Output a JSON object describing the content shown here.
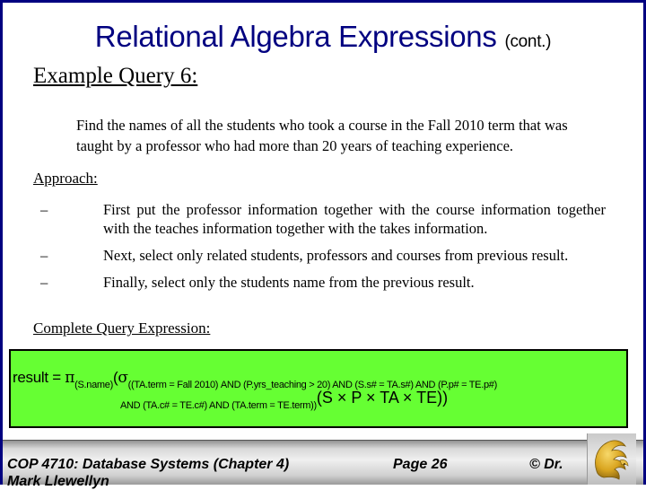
{
  "slide": {
    "title": "Relational Algebra Expressions",
    "title_suffix": "(cont.)",
    "query_heading": "Example Query 6:",
    "description": "Find the names of all the students who took a course in the Fall 2010 term that was taught by a professor who had more than 20 years of teaching experience.",
    "approach_heading": "Approach:",
    "bullets": [
      {
        "marker": "–",
        "text": "First put the professor information together with the course information together with the teaches information together with the takes information."
      },
      {
        "marker": "–",
        "text": "Next,  select only related students, professors and courses from previous result."
      },
      {
        "marker": "–",
        "text": "Finally, select only the students name from the previous result."
      }
    ],
    "complete_heading": "Complete Query Expression:",
    "expression": {
      "lhs": "result = ",
      "pi": "π",
      "pi_sub": "(S.name)",
      "open": "(",
      "sigma": "σ",
      "sigma_sub_line1": "((TA.term = Fall 2010) AND (P.yrs_teaching > 20) AND (S.s# = TA.s#) AND (P.p# = TE.p#)",
      "sigma_sub_line2": "AND  (TA.c# = TE.c#)  AND (TA.term = TE.term))",
      "operand": "(S × P × TA × TE))"
    },
    "colors": {
      "frame": "#000080",
      "title": "#000080",
      "query_box": "#66FF33"
    }
  },
  "footer": {
    "course": "COP 4710: Database Systems  (Chapter 4)",
    "page": "Page 26",
    "copyright": "© Dr.",
    "author_overflow": "Mark Llewellyn",
    "logo": "ucf-pegasus-logo"
  }
}
